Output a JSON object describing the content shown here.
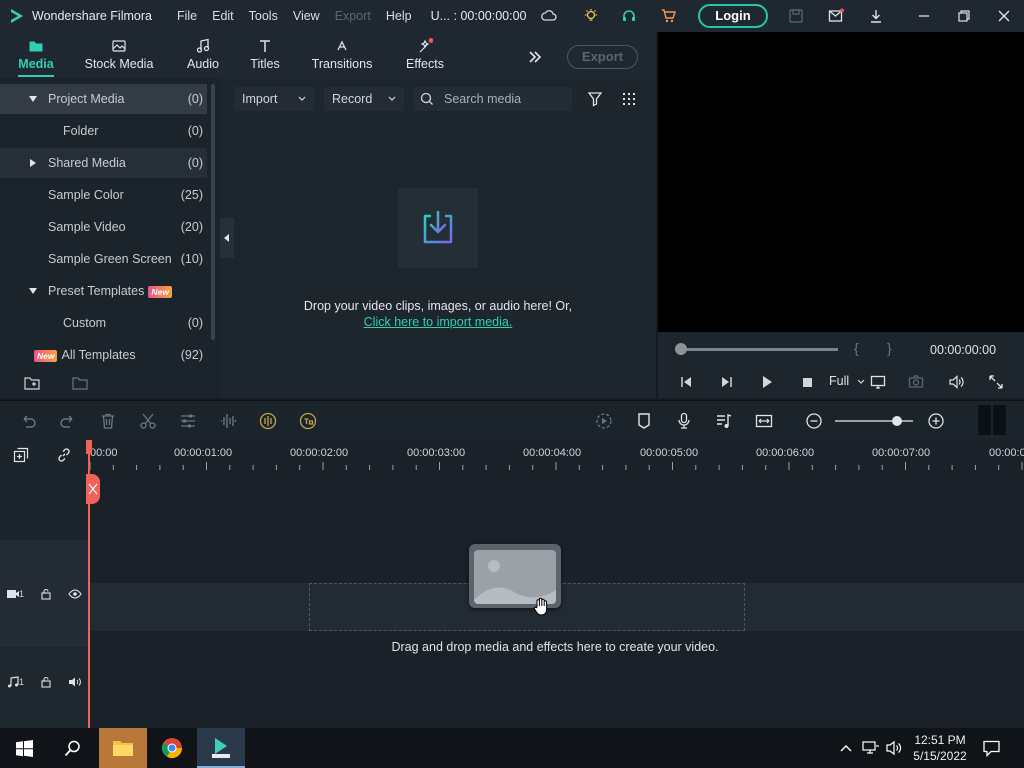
{
  "app": {
    "name": "Wondershare Filmora",
    "project_title": "U... : 00:00:00:00",
    "login_label": "Login",
    "accent": "#2ed0b4"
  },
  "menu": [
    "File",
    "Edit",
    "Tools",
    "View",
    "Export",
    "Help"
  ],
  "tabs": [
    {
      "label": "Media",
      "icon": "folder-icon",
      "active": true
    },
    {
      "label": "Stock Media",
      "icon": "stock-media-icon"
    },
    {
      "label": "Audio",
      "icon": "music-note-icon"
    },
    {
      "label": "Titles",
      "icon": "text-t-icon"
    },
    {
      "label": "Transitions",
      "icon": "transitions-icon"
    },
    {
      "label": "Effects",
      "icon": "effects-icon"
    }
  ],
  "export_label": "Export",
  "sidebar": {
    "items": [
      {
        "label": "Project Media",
        "count": "(0)"
      },
      {
        "label": "Folder",
        "count": "(0)"
      },
      {
        "label": "Shared Media",
        "count": "(0)"
      },
      {
        "label": "Sample Color",
        "count": "(25)"
      },
      {
        "label": "Sample Video",
        "count": "(20)"
      },
      {
        "label": "Sample Green Screen",
        "count": "(10)"
      },
      {
        "label": "Preset Templates",
        "badge": "New"
      },
      {
        "label": "Custom",
        "count": "(0)"
      },
      {
        "label": "All Templates",
        "count": "(92)",
        "badge": "New"
      }
    ]
  },
  "media": {
    "import_label": "Import",
    "record_label": "Record",
    "search_placeholder": "Search media",
    "drop_text": "Drop your video clips, images, or audio here! Or,",
    "import_link": "Click here to import media."
  },
  "preview": {
    "timecode": "00:00:00:00",
    "brace_open": "{",
    "brace_close": "}",
    "quality": "Full"
  },
  "timeline": {
    "ruler": [
      "00:00",
      "00:00:01:00",
      "00:00:02:00",
      "00:00:03:00",
      "00:00:04:00",
      "00:00:05:00",
      "00:00:06:00",
      "00:00:07:00",
      "00:00:0"
    ],
    "video_track_num": "1",
    "audio_track_num": "1",
    "hint": "Drag and drop media and effects here to create your video."
  },
  "taskbar": {
    "time": "12:51 PM",
    "date": "5/15/2022"
  }
}
